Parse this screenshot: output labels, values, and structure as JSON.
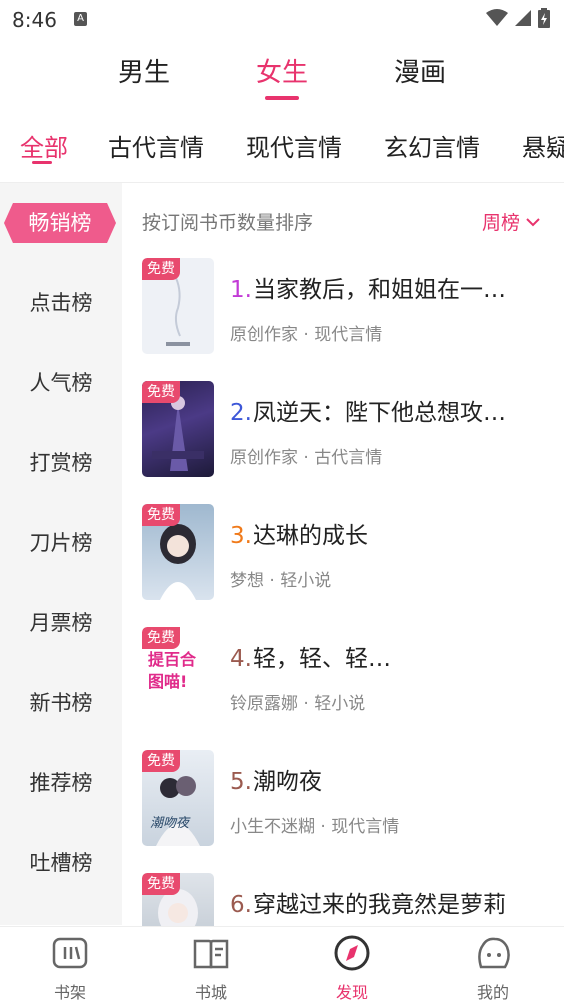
{
  "status_bar": {
    "time": "8:46",
    "notification_badge": "A"
  },
  "gender_tabs": [
    {
      "label": "男生",
      "active": false
    },
    {
      "label": "女生",
      "active": true
    },
    {
      "label": "漫画",
      "active": false
    }
  ],
  "category_tabs": [
    {
      "label": "全部",
      "active": true
    },
    {
      "label": "古代言情",
      "active": false
    },
    {
      "label": "现代言情",
      "active": false
    },
    {
      "label": "玄幻言情",
      "active": false
    },
    {
      "label": "悬疑",
      "active": false
    }
  ],
  "sidebar": {
    "items": [
      {
        "label": "畅销榜",
        "active": true
      },
      {
        "label": "点击榜",
        "active": false
      },
      {
        "label": "人气榜",
        "active": false
      },
      {
        "label": "打赏榜",
        "active": false
      },
      {
        "label": "刀片榜",
        "active": false
      },
      {
        "label": "月票榜",
        "active": false
      },
      {
        "label": "新书榜",
        "active": false
      },
      {
        "label": "推荐榜",
        "active": false
      },
      {
        "label": "吐槽榜",
        "active": false
      }
    ]
  },
  "sort": {
    "label": "按订阅书币数量排序",
    "period": "周榜"
  },
  "books": [
    {
      "rank": "1.",
      "rank_color": "#c23ad6",
      "title": "当家教后，和姐姐在一…",
      "author": "原创作家",
      "genre": "现代言情",
      "tag": "免费",
      "cover_text": ""
    },
    {
      "rank": "2.",
      "rank_color": "#3d57d8",
      "title": "凤逆天：陛下他总想攻…",
      "author": "原创作家",
      "genre": "古代言情",
      "tag": "免费",
      "cover_text": ""
    },
    {
      "rank": "3.",
      "rank_color": "#f07a1a",
      "title": "达琳的成长",
      "author": "梦想",
      "genre": "轻小说",
      "tag": "免费",
      "cover_text": ""
    },
    {
      "rank": "4.",
      "rank_color": "#9b5a4f",
      "title": "轻，轻、轻…",
      "author": "铃原露娜",
      "genre": "轻小说",
      "tag": "免费",
      "cover_text": "提百合图喵!"
    },
    {
      "rank": "5.",
      "rank_color": "#9b5a4f",
      "title": "潮吻夜",
      "author": "小生不迷糊",
      "genre": "现代言情",
      "tag": "免费",
      "cover_text": "潮吻夜"
    },
    {
      "rank": "6.",
      "rank_color": "#9b5a4f",
      "title": "穿越过来的我竟然是萝莉",
      "author": "",
      "genre": "",
      "tag": "免费",
      "cover_text": ""
    }
  ],
  "bottom_nav": [
    {
      "label": "书架",
      "icon": "bookshelf-icon",
      "active": false
    },
    {
      "label": "书城",
      "icon": "bookstore-icon",
      "active": false
    },
    {
      "label": "发现",
      "icon": "compass-icon",
      "active": true
    },
    {
      "label": "我的",
      "icon": "profile-icon",
      "active": false
    }
  ],
  "colors": {
    "accent": "#e8336d",
    "free_tag": "#e84a6e",
    "sidebar_bg": "#f5f5f5"
  }
}
